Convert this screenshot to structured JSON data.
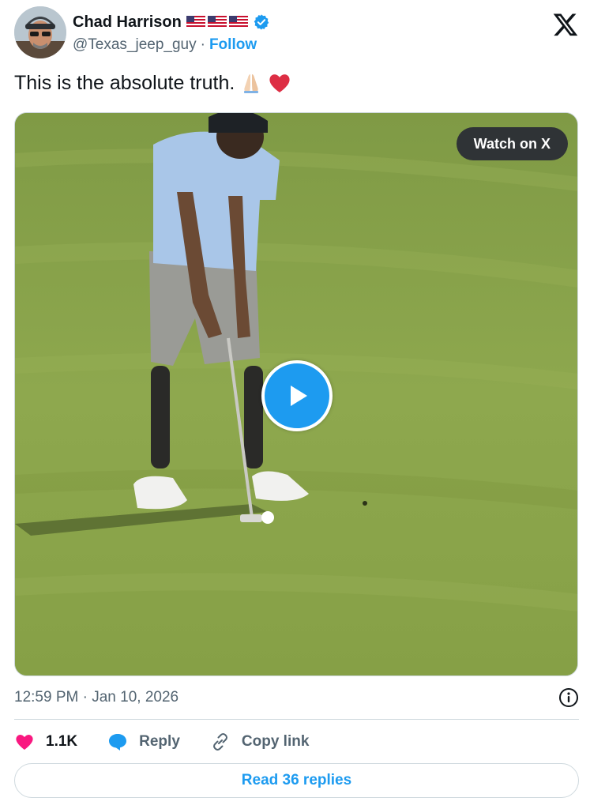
{
  "author": {
    "display_name": "Chad Harrison",
    "flag_emojis": [
      "us-flag",
      "us-flag",
      "us-flag"
    ],
    "verified_icon": "verified-badge-icon",
    "handle": "@Texas_jeep_guy",
    "separator": "·",
    "follow_label": "Follow"
  },
  "tweet": {
    "text": "This is the absolute truth.",
    "emojis": [
      "folded-hands-emoji",
      "red-heart-emoji"
    ]
  },
  "media": {
    "watch_label": "Watch on X",
    "play_icon": "play-icon"
  },
  "meta": {
    "timestamp": "12:59 PM · Jan 10, 2026",
    "info_icon": "info-icon"
  },
  "actions": {
    "like_count": "1.1K",
    "reply_label": "Reply",
    "copy_link_label": "Copy link"
  },
  "footer": {
    "read_replies_label": "Read 36 replies"
  },
  "colors": {
    "accent": "#1d9bf0",
    "like": "#f91880",
    "text_secondary": "#536471",
    "border": "#cfd9de"
  }
}
